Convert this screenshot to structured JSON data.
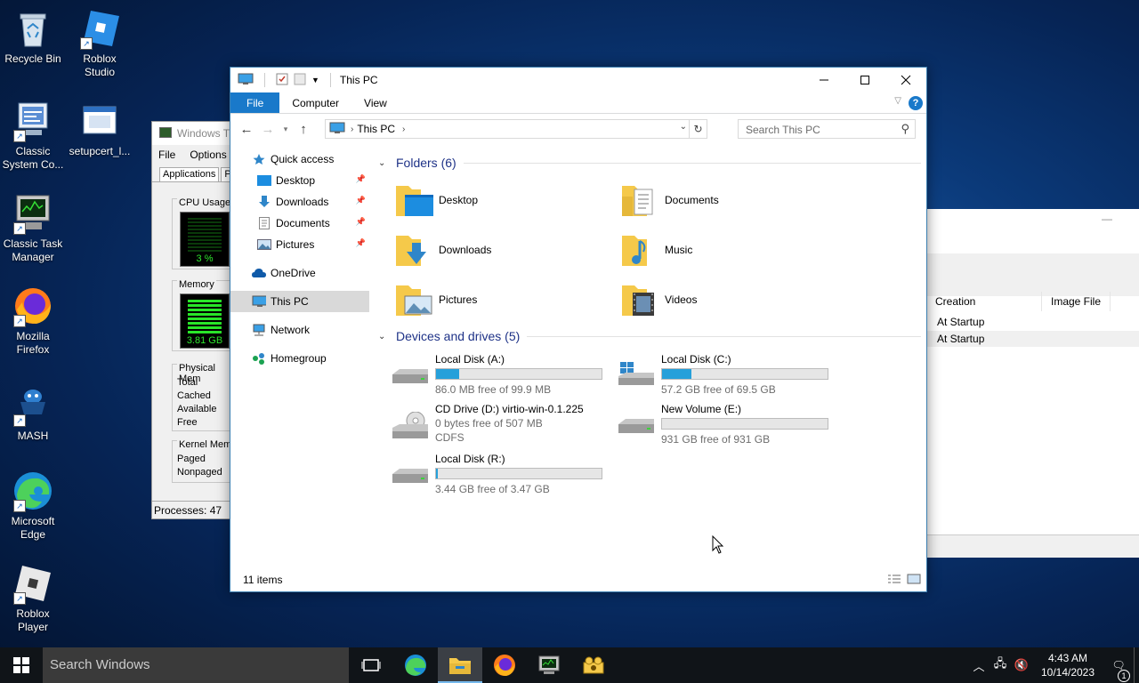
{
  "desktop": {
    "icons": [
      {
        "label": "Recycle Bin"
      },
      {
        "label": "Roblox Studio"
      },
      {
        "label": "Classic System Co..."
      },
      {
        "label": "setupcert_l..."
      },
      {
        "label": "Classic Task Manager"
      },
      {
        "label": "Mozilla Firefox"
      },
      {
        "label": "MASH"
      },
      {
        "label": "Microsoft Edge"
      },
      {
        "label": "Roblox Player"
      }
    ]
  },
  "taskmgr": {
    "title": "Windows T",
    "menu": [
      "File",
      "Options"
    ],
    "tabs": [
      "Applications",
      "P"
    ],
    "cpu_label": "CPU Usage",
    "cpu_value": "3 %",
    "mem_label": "Memory",
    "mem_value": "3.81 GB",
    "phys_label": "Physical Mem",
    "phys_rows": [
      "Total",
      "Cached",
      "Available",
      "Free"
    ],
    "kernel_label": "Kernel Memo",
    "kernel_rows": [
      "Paged",
      "Nonpaged"
    ],
    "status": "Processes: 47"
  },
  "bgwin": {
    "min": "—",
    "columns": [
      "Creation",
      "Image File"
    ],
    "rows": [
      "At Startup",
      "At Startup"
    ]
  },
  "explorer": {
    "title": "This PC",
    "ribbon": {
      "file": "File",
      "computer": "Computer",
      "view": "View",
      "help": "?"
    },
    "address": {
      "crumb": "This PC"
    },
    "search_placeholder": "Search This PC",
    "nav": {
      "quick_access": "Quick access",
      "desktop": "Desktop",
      "downloads": "Downloads",
      "documents": "Documents",
      "pictures": "Pictures",
      "onedrive": "OneDrive",
      "this_pc": "This PC",
      "network": "Network",
      "homegroup": "Homegroup"
    },
    "folders_header": "Folders (6)",
    "folders": [
      "Desktop",
      "Documents",
      "Downloads",
      "Music",
      "Pictures",
      "Videos"
    ],
    "drives_header": "Devices and drives (5)",
    "drives": [
      {
        "name": "Local Disk (A:)",
        "free": "86.0 MB free of 99.9 MB",
        "used": 0.14
      },
      {
        "name": "Local Disk (C:)",
        "free": "57.2 GB free of 69.5 GB",
        "used": 0.18
      },
      {
        "name": "CD Drive (D:) virtio-win-0.1.225",
        "free": "0 bytes free of 507 MB",
        "fs": "CDFS"
      },
      {
        "name": "New Volume (E:)",
        "free": "931 GB free of 931 GB",
        "used": 0.0
      },
      {
        "name": "Local Disk (R:)",
        "free": "3.44 GB free of 3.47 GB",
        "used": 0.01
      }
    ],
    "status_items": "11 items"
  },
  "taskbar": {
    "search_placeholder": "Search Windows",
    "time": "4:43 AM",
    "date": "10/14/2023",
    "notif_count": "1"
  },
  "colors": {
    "accent": "#1979ca",
    "drive_fill": "#26a0da",
    "header_blue": "#1e3287"
  }
}
